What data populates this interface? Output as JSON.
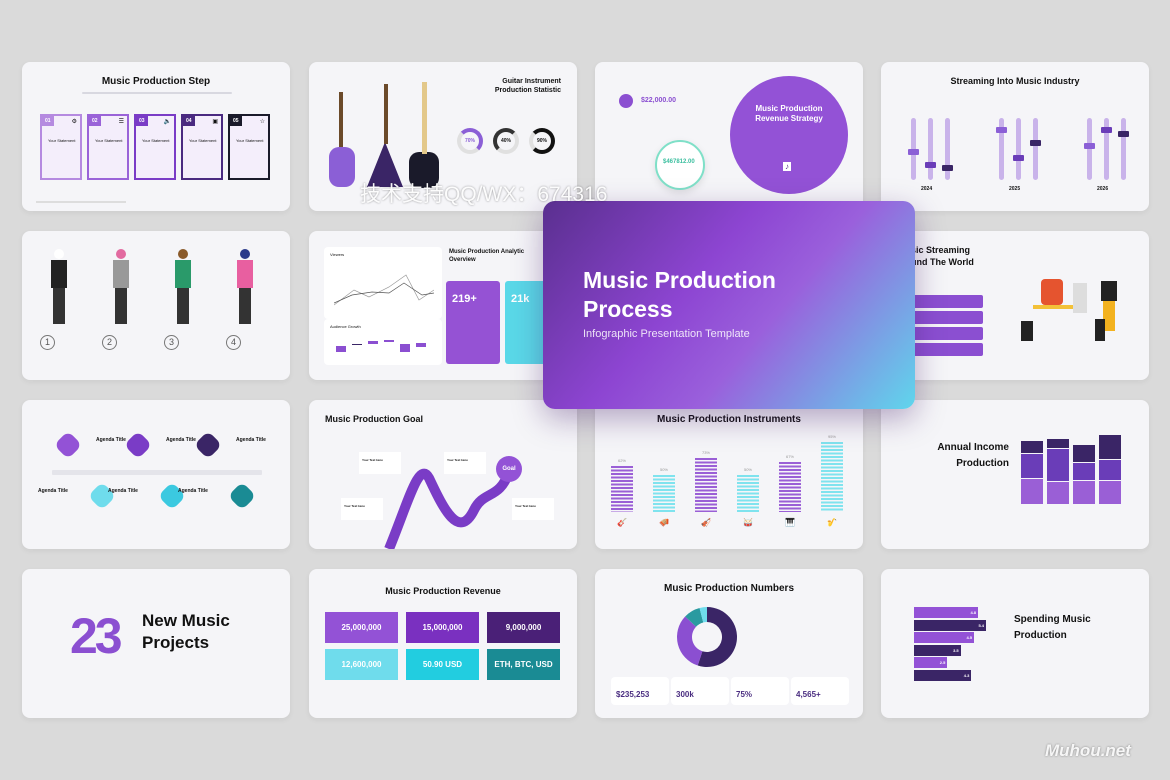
{
  "hero": {
    "title_line1": "Music Production",
    "title_line2": "Process",
    "subtitle": "Infographic Presentation Template"
  },
  "colors": {
    "purple": "#8b4fd1",
    "dark_purple": "#3a2566",
    "cyan": "#5fd9e8",
    "teal": "#1a8b94",
    "background": "#dadada"
  },
  "slides": {
    "step": {
      "title": "Music Production Step",
      "steps": [
        {
          "num": "01",
          "label": "Your Statement",
          "icon": "gear-icon"
        },
        {
          "num": "02",
          "label": "Your Statement",
          "icon": "sliders-icon"
        },
        {
          "num": "03",
          "label": "Your Statement",
          "icon": "speaker-icon"
        },
        {
          "num": "04",
          "label": "Your Statement",
          "icon": "image-icon"
        },
        {
          "num": "05",
          "label": "Your Statement",
          "icon": "star-icon"
        }
      ]
    },
    "guitar": {
      "title_line1": "Guitar Instrument",
      "title_line2": "Production Statistic",
      "stats": [
        "70%",
        "40%",
        "90%"
      ]
    },
    "revenue_strategy": {
      "title_line1": "Music Production",
      "title_line2": "Revenue Strategy",
      "amount1": "$22,000.00",
      "amount2": "$467812.00"
    },
    "streaming": {
      "title": "Streaming Into Music Industry",
      "years": [
        "2024",
        "2025",
        "2026"
      ]
    },
    "musicians": {
      "numbers": [
        "1",
        "2",
        "3",
        "4"
      ]
    },
    "analytic": {
      "title_line1": "Music Production Analytic",
      "title_line2": "Overview",
      "chart1": "Viewers",
      "chart2": "Audience Growth",
      "stat1": "219+",
      "stat2": "21k"
    },
    "streaming_world": {
      "title_line1": "sic Streaming",
      "title_line2": "und The World"
    },
    "agenda": {
      "item_label": "Agenda Title"
    },
    "goal": {
      "title": "Music Production Goal",
      "goal_label": "Goal",
      "note_label": "Your Text Here"
    },
    "instruments": {
      "title": "Music Production Instruments"
    },
    "annual": {
      "title_line1": "Annual Income",
      "title_line2": "Production"
    },
    "projects": {
      "number": "23",
      "title_line1": "New Music",
      "title_line2": "Projects"
    },
    "revenue": {
      "title": "Music Production Revenue",
      "boxes": [
        "25,000,000",
        "15,000,000",
        "9,000,000",
        "12,600,000",
        "50.90 USD",
        "ETH, BTC, USD"
      ]
    },
    "numbers": {
      "title": "Music Production Numbers",
      "stats": [
        "$235,253",
        "300k",
        "75%",
        "4,565+"
      ]
    },
    "spending": {
      "title_line1": "Spending Music",
      "title_line2": "Production",
      "bar_labels": [
        "4.8",
        "5.4",
        "4.5",
        "3.5",
        "2.5",
        "4.3"
      ]
    }
  },
  "chart_data": [
    {
      "type": "bar",
      "categories": [
        "electric guitar",
        "accordion",
        "violin",
        "drum",
        "piano",
        "saxophone"
      ],
      "values": [
        62,
        50,
        73,
        50,
        67,
        95
      ],
      "ylim": [
        0,
        100
      ]
    },
    {
      "type": "bar",
      "orientation": "horizontal",
      "values": [
        4.8,
        5.4,
        4.5,
        3.5,
        2.5,
        4.3
      ]
    },
    {
      "type": "pie",
      "values": [
        55,
        32,
        9,
        4
      ],
      "colors": [
        "#3a2566",
        "#8b4fd1",
        "#2a9aa0",
        "#6fdcec"
      ]
    }
  ],
  "watermarks": {
    "top": "技术支持QQ/WX：674316",
    "bottom": "Muhou.net"
  }
}
